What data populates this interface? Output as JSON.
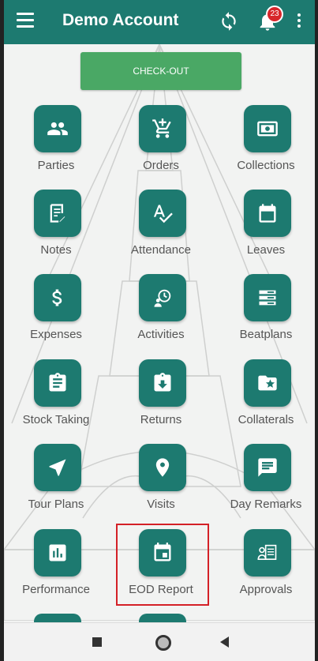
{
  "header": {
    "title": "Demo Account",
    "notification_count": "23"
  },
  "checkout_label": "CHECK-OUT",
  "grid": [
    {
      "label": "Parties",
      "icon": "people-icon"
    },
    {
      "label": "Orders",
      "icon": "cart-icon"
    },
    {
      "label": "Collections",
      "icon": "cash-icon"
    },
    {
      "label": "Notes",
      "icon": "note-icon"
    },
    {
      "label": "Attendance",
      "icon": "spellcheck-icon"
    },
    {
      "label": "Leaves",
      "icon": "calendar-icon"
    },
    {
      "label": "Expenses",
      "icon": "dollar-icon"
    },
    {
      "label": "Activities",
      "icon": "activity-icon"
    },
    {
      "label": "Beatplans",
      "icon": "list-icon"
    },
    {
      "label": "Stock Taking",
      "icon": "clipboard-icon"
    },
    {
      "label": "Returns",
      "icon": "return-icon"
    },
    {
      "label": "Collaterals",
      "icon": "folder-star-icon"
    },
    {
      "label": "Tour Plans",
      "icon": "navigation-icon"
    },
    {
      "label": "Visits",
      "icon": "location-pin-icon"
    },
    {
      "label": "Day Remarks",
      "icon": "comment-icon"
    },
    {
      "label": "Performance",
      "icon": "bar-chart-icon"
    },
    {
      "label": "EOD Report",
      "icon": "event-icon"
    },
    {
      "label": "Approvals",
      "icon": "approval-icon"
    }
  ],
  "colors": {
    "primary": "#1d7a70",
    "checkout": "#4aa865",
    "badge": "#d7262b",
    "highlight": "#d42027"
  }
}
